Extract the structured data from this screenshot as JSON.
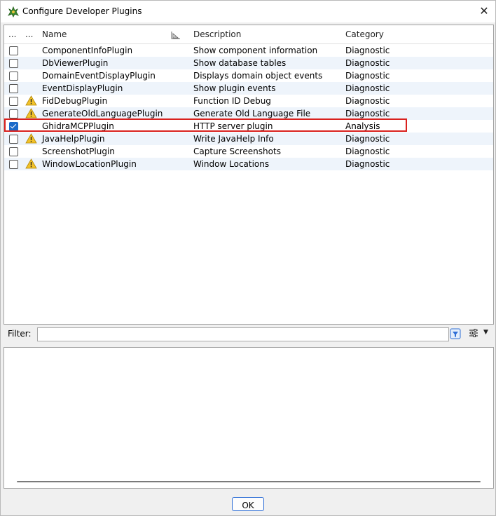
{
  "window": {
    "title": "Configure Developer Plugins",
    "close_glyph": "✕"
  },
  "table": {
    "columns": {
      "col1": "...",
      "col2": "...",
      "name": "Name",
      "description": "Description",
      "category": "Category"
    },
    "rows": [
      {
        "checked": false,
        "warning": false,
        "name": "ComponentInfoPlugin",
        "description": "Show component information",
        "category": "Diagnostic"
      },
      {
        "checked": false,
        "warning": false,
        "name": "DbViewerPlugin",
        "description": "Show database tables",
        "category": "Diagnostic"
      },
      {
        "checked": false,
        "warning": false,
        "name": "DomainEventDisplayPlugin",
        "description": "Displays domain object events",
        "category": "Diagnostic"
      },
      {
        "checked": false,
        "warning": false,
        "name": "EventDisplayPlugin",
        "description": "Show plugin events",
        "category": "Diagnostic"
      },
      {
        "checked": false,
        "warning": true,
        "name": "FidDebugPlugin",
        "description": "Function ID Debug",
        "category": "Diagnostic"
      },
      {
        "checked": false,
        "warning": true,
        "name": "GenerateOldLanguagePlugin",
        "description": "Generate Old Language File",
        "category": "Diagnostic"
      },
      {
        "checked": true,
        "warning": false,
        "name": "GhidraMCPPlugin",
        "description": "HTTP server plugin",
        "category": "Analysis"
      },
      {
        "checked": false,
        "warning": true,
        "name": "JavaHelpPlugin",
        "description": "Write JavaHelp Info",
        "category": "Diagnostic"
      },
      {
        "checked": false,
        "warning": false,
        "name": "ScreenshotPlugin",
        "description": "Capture Screenshots",
        "category": "Diagnostic"
      },
      {
        "checked": false,
        "warning": true,
        "name": "WindowLocationPlugin",
        "description": "Window Locations",
        "category": "Diagnostic"
      }
    ]
  },
  "filter": {
    "label": "Filter:",
    "value": ""
  },
  "buttons": {
    "ok": "OK"
  },
  "colors": {
    "accent": "#1b6ac9",
    "highlight": "#d9211e",
    "row_alt": "#eef4fb",
    "warning": "#f2c22a"
  },
  "icons": {
    "app": "dragon-app-icon",
    "sort": "sort-icon",
    "warning": "warning-icon",
    "filter_action": "filter-clear-icon",
    "options": "filter-options-icon"
  }
}
